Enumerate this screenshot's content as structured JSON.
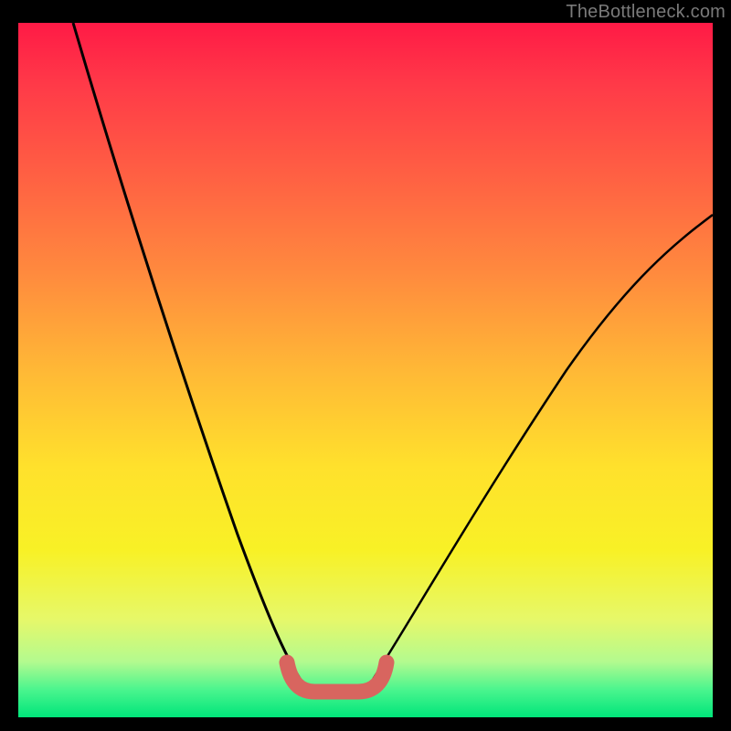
{
  "watermark": "TheBottleneck.com",
  "chart_data": {
    "type": "line",
    "title": "",
    "xlabel": "",
    "ylabel": "",
    "xlim": [
      0,
      100
    ],
    "ylim": [
      0,
      100
    ],
    "series": [
      {
        "name": "left-curve",
        "x": [
          8,
          12,
          16,
          20,
          24,
          28,
          32,
          36,
          38,
          40,
          42
        ],
        "y": [
          100,
          84,
          67,
          51,
          37,
          25,
          15,
          8,
          5,
          3.5,
          3.5
        ]
      },
      {
        "name": "flat-segment",
        "x": [
          42,
          50
        ],
        "y": [
          3.5,
          3.5
        ]
      },
      {
        "name": "right-curve",
        "x": [
          50,
          52,
          56,
          60,
          66,
          74,
          82,
          90,
          100
        ],
        "y": [
          3.5,
          5,
          10,
          16,
          25,
          37,
          49,
          60,
          72
        ]
      }
    ],
    "highlight": {
      "name": "bottom-U",
      "x": [
        38,
        42,
        50,
        52
      ],
      "y": [
        7,
        3.5,
        3.5,
        7
      ]
    },
    "gradient_stops": [
      {
        "pos": 0,
        "color": "#ff1a46"
      },
      {
        "pos": 22,
        "color": "#ff6043"
      },
      {
        "pos": 50,
        "color": "#ffb836"
      },
      {
        "pos": 76,
        "color": "#f8f126"
      },
      {
        "pos": 96,
        "color": "#4bf58e"
      },
      {
        "pos": 100,
        "color": "#00e57a"
      }
    ]
  }
}
